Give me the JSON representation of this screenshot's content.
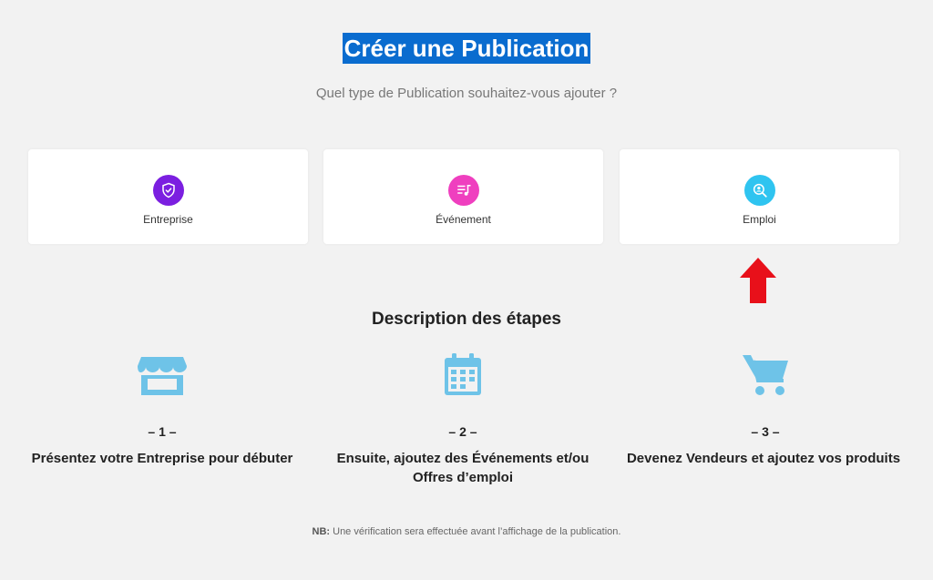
{
  "header": {
    "title": "Créer une Publication",
    "subtitle": "Quel type de Publication souhaitez-vous ajouter ?"
  },
  "cards": [
    {
      "label": "Entreprise",
      "icon": "shield-check-icon",
      "color": "#7b1fe0"
    },
    {
      "label": "Événement",
      "icon": "music-playlist-icon",
      "color": "#ef3fbf"
    },
    {
      "label": "Emploi",
      "icon": "search-user-icon",
      "color": "#2fc4f0"
    }
  ],
  "annotation": {
    "icon": "red-arrow-up-icon",
    "color": "#e8101a"
  },
  "steps_section": {
    "title": "Description des étapes",
    "icon_color": "#6ec3e8",
    "steps": [
      {
        "number": "– 1 –",
        "text_line1": "Présentez votre Entreprise pour débuter",
        "text_line2": "",
        "icon": "storefront-icon"
      },
      {
        "number": "– 2 –",
        "text_line1": "Ensuite, ajoutez des Événements et/ou",
        "text_line2": "Offres d’emploi",
        "icon": "calendar-icon"
      },
      {
        "number": "– 3 –",
        "text_line1": "Devenez Vendeurs et ajoutez vos produits",
        "text_line2": "",
        "icon": "shopping-cart-icon"
      }
    ]
  },
  "note": {
    "label": "NB:",
    "text": " Une vérification sera effectuée avant l’affichage de la publication."
  }
}
